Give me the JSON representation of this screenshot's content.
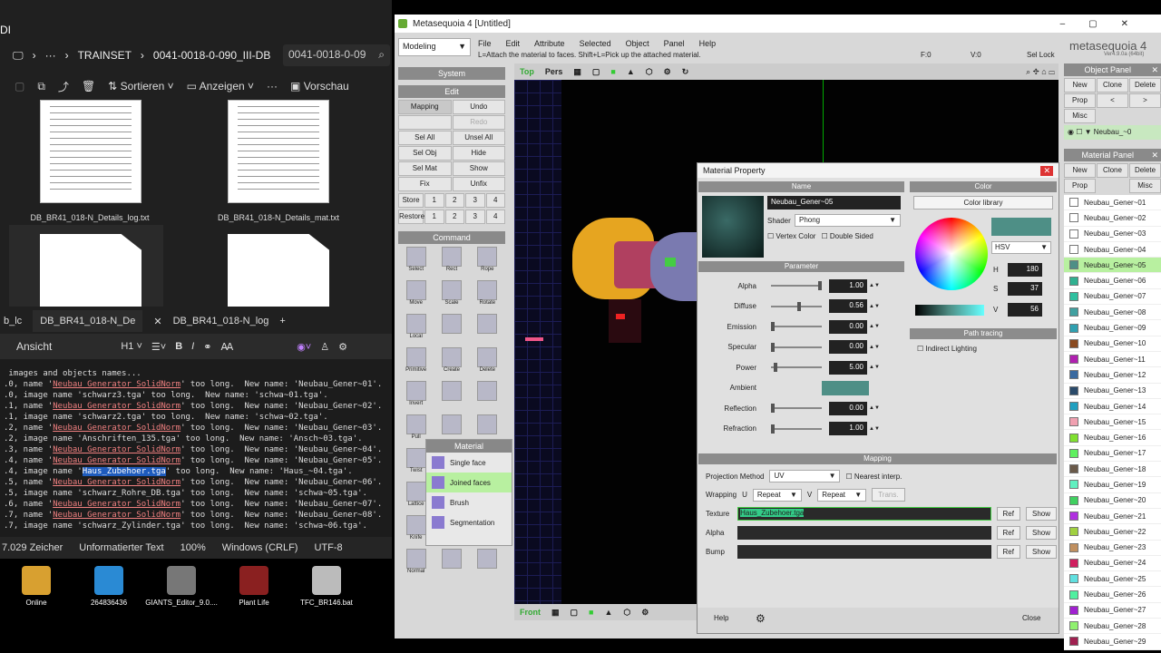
{
  "explorer": {
    "title_fragment": "DI",
    "breadcrumb": [
      "TRAINSET",
      "0041-0018-0-090_III-DB"
    ],
    "search_text": "0041-0018-0-09",
    "toolbar": {
      "sort": "Sortieren",
      "view": "Anzeigen",
      "more": "···",
      "preview": "Vorschau"
    },
    "files": [
      "DB_BR41_018-N_Details_log.txt",
      "DB_BR41_018-N_Details_mat.txt"
    ]
  },
  "editor": {
    "tabs": [
      "b_lc",
      "DB_BR41_018-N_De",
      "DB_BR41_018-N_log",
      "+"
    ],
    "view_label": "Ansicht",
    "heading_sel": "H1",
    "lines": [
      {
        "pre": " images and objects names...",
        "hl": "",
        "post": ""
      },
      {
        "pre": ".0, name '",
        "hl": "Neubau_Generator_SolidNorm",
        "post": "' too long.  New name: 'Neubau_Gener~01'."
      },
      {
        "pre": ".0, image name 'schwarz3.tga' too long.  New name: 'schwa~01.tga'.",
        "hl": "",
        "post": ""
      },
      {
        "pre": ".1, name '",
        "hl": "Neubau_Generator_SolidNorm",
        "post": "' too long.  New name: 'Neubau_Gener~02'."
      },
      {
        "pre": ".1, image name 'schwarz2.tga' too long.  New name: 'schwa~02.tga'.",
        "hl": "",
        "post": ""
      },
      {
        "pre": ".2, name '",
        "hl": "Neubau_Generator_SolidNorm",
        "post": "' too long.  New name: 'Neubau_Gener~03'."
      },
      {
        "pre": ".2, image name 'Anschriften_135.tga' too long.  New name: 'Ansch~03.tga'.",
        "hl": "",
        "post": ""
      },
      {
        "pre": ".3, name '",
        "hl": "Neubau_Generator_SolidNorm",
        "post": "' too long.  New name: 'Neubau_Gener~04'."
      },
      {
        "pre": ".4, name '",
        "hl": "Neubau_Generator_SolidNorm",
        "post": "' too long.  New name: 'Neubau_Gener~05'."
      },
      {
        "pre": ".4, image name '",
        "sel": "Haus_Zubehoer.tga",
        "post": "' too long.  New name: 'Haus_~04.tga'."
      },
      {
        "pre": ".5, name '",
        "hl": "Neubau_Generator_SolidNorm",
        "post": "' too long.  New name: 'Neubau_Gener~06'."
      },
      {
        "pre": ".5, image name 'schwarz_Rohre_DB.tga' too long.  New name: 'schwa~05.tga'.",
        "hl": "",
        "post": ""
      },
      {
        "pre": ".6, name '",
        "hl": "Neubau_Generator_SolidNorm",
        "post": "' too long.  New name: 'Neubau_Gener~07'."
      },
      {
        "pre": ".7, name '",
        "hl": "Neubau_Generator_SolidNorm",
        "post": "' too long.  New name: 'Neubau_Gener~08'."
      },
      {
        "pre": ".7, image name 'schwarz_Zylinder.tga' too long.  New name: 'schwa~06.tga'.",
        "hl": "",
        "post": ""
      }
    ],
    "status": {
      "chars": "7.029 Zeicher",
      "format": "Unformatierter Text",
      "zoom": "100%",
      "eol": "Windows (CRLF)",
      "enc": "UTF-8"
    }
  },
  "desktop": [
    {
      "label": "Online",
      "color": "#d8a030"
    },
    {
      "label": "264836436",
      "color": "#2a8ad4"
    },
    {
      "label": "GIANTS_Editor_9.0....",
      "color": "#777777"
    },
    {
      "label": "Plant Life",
      "color": "#8a2020"
    },
    {
      "label": "TFC_BR146.bat",
      "color": "#bbbbbb"
    }
  ],
  "meta": {
    "title": "Metasequoia 4 [Untitled]",
    "mode": "Modeling",
    "menu": [
      "File",
      "Edit",
      "Attribute",
      "Selected",
      "Object",
      "Panel",
      "Help"
    ],
    "hint": "L=Attach the material to faces.  Shift+L=Pick up the attached material.",
    "status_f": "F:0",
    "status_v": "V:0",
    "sel_lock": "Sel Lock",
    "logo": "metasequoia 4",
    "version": "Ver4.9.0a (64bit)",
    "system_label": "System",
    "edit_label": "Edit",
    "edit_buttons": [
      "Mapping",
      "Undo",
      "",
      "Redo",
      "Sel All",
      "Unsel All",
      "Sel Obj",
      "Hide",
      "Sel Mat",
      "Show",
      "Fix",
      "Unfix"
    ],
    "store_label": "Store",
    "restore_label": "Restore",
    "slots": [
      "1",
      "2",
      "3",
      "4"
    ],
    "command_label": "Command",
    "commands": [
      "Select",
      "Rect",
      "Rope",
      "Move",
      "Scale",
      "Rotate",
      "Local",
      "",
      "",
      "Primitive",
      "Create",
      "Delete",
      "Invert",
      "",
      "",
      "Pull",
      "",
      "",
      "Twist",
      "",
      "",
      "Lattice",
      "Hole",
      "Bridge",
      "Knife",
      "Weight",
      "VertClr",
      "Normal",
      "",
      ""
    ],
    "view_top": [
      "Top",
      "Pers"
    ],
    "view_bottom": "Front",
    "flyout_title": "Material",
    "flyout_items": [
      "Single face",
      "Joined faces",
      "Brush",
      "Segmentation"
    ]
  },
  "object_panel": {
    "title": "Object Panel",
    "buttons": [
      "New",
      "Clone",
      "Delete",
      "Prop",
      "<",
      ">",
      "Misc"
    ],
    "item": "Neubau_~0"
  },
  "material_panel": {
    "title": "Material Panel",
    "buttons": [
      "New",
      "Clone",
      "Delete",
      "Prop",
      "Misc"
    ],
    "items": [
      {
        "name": "Neubau_Gener~01",
        "color": "#ffffff"
      },
      {
        "name": "Neubau_Gener~02",
        "color": "#ffffff"
      },
      {
        "name": "Neubau_Gener~03",
        "color": "#ffffff"
      },
      {
        "name": "Neubau_Gener~04",
        "color": "#ffffff"
      },
      {
        "name": "Neubau_Gener~05",
        "color": "#4e8f86"
      },
      {
        "name": "Neubau_Gener~06",
        "color": "#30b090"
      },
      {
        "name": "Neubau_Gener~07",
        "color": "#30c0a0"
      },
      {
        "name": "Neubau_Gener~08",
        "color": "#40a0a0"
      },
      {
        "name": "Neubau_Gener~09",
        "color": "#30a0b0"
      },
      {
        "name": "Neubau_Gener~10",
        "color": "#8a4a20"
      },
      {
        "name": "Neubau_Gener~11",
        "color": "#b020b0"
      },
      {
        "name": "Neubau_Gener~12",
        "color": "#3a6aa0"
      },
      {
        "name": "Neubau_Gener~13",
        "color": "#2a4a6a"
      },
      {
        "name": "Neubau_Gener~14",
        "color": "#20a0c0"
      },
      {
        "name": "Neubau_Gener~15",
        "color": "#f0a0b0"
      },
      {
        "name": "Neubau_Gener~16",
        "color": "#80e030"
      },
      {
        "name": "Neubau_Gener~17",
        "color": "#60f060"
      },
      {
        "name": "Neubau_Gener~18",
        "color": "#6a5a4a"
      },
      {
        "name": "Neubau_Gener~19",
        "color": "#60f0c0"
      },
      {
        "name": "Neubau_Gener~20",
        "color": "#40d060"
      },
      {
        "name": "Neubau_Gener~21",
        "color": "#b030e0"
      },
      {
        "name": "Neubau_Gener~22",
        "color": "#a0d040"
      },
      {
        "name": "Neubau_Gener~23",
        "color": "#c09060"
      },
      {
        "name": "Neubau_Gener~24",
        "color": "#d02060"
      },
      {
        "name": "Neubau_Gener~25",
        "color": "#60e0e0"
      },
      {
        "name": "Neubau_Gener~26",
        "color": "#50f0a0"
      },
      {
        "name": "Neubau_Gener~27",
        "color": "#a020d0"
      },
      {
        "name": "Neubau_Gener~28",
        "color": "#90f070"
      },
      {
        "name": "Neubau_Gener~29",
        "color": "#a02050"
      }
    ]
  },
  "dialog": {
    "title": "Material Property",
    "name_section": "Name",
    "material_name": "Neubau_Gener~05",
    "shader_label": "Shader",
    "shader_value": "Phong",
    "vertex_color": "Vertex Color",
    "double_sided": "Double Sided",
    "param_section": "Parameter",
    "params": [
      {
        "label": "Alpha",
        "value": "1.00",
        "level": 1.0
      },
      {
        "label": "Diffuse",
        "value": "0.56",
        "level": 0.56
      },
      {
        "label": "Emission",
        "value": "0.00",
        "level": 0.0
      },
      {
        "label": "Specular",
        "value": "0.00",
        "level": 0.0
      },
      {
        "label": "Power",
        "value": "5.00",
        "level": 0.05
      },
      {
        "label": "Ambient",
        "value": "",
        "level": -1
      },
      {
        "label": "Reflection",
        "value": "0.00",
        "level": 0.0
      },
      {
        "label": "Refraction",
        "value": "1.00",
        "level": 0.0
      }
    ],
    "color_section": "Color",
    "color_library": "Color library",
    "color_mode": "HSV",
    "h_label": "H",
    "h_value": "180",
    "s_label": "S",
    "s_value": "37",
    "v_label": "V",
    "v_value": "56",
    "material_color": "#4e8f86",
    "path_section": "Path tracing",
    "indirect": "Indirect Lighting",
    "mapping_section": "Mapping",
    "proj_label": "Projection Method",
    "proj_value": "UV",
    "nearest": "Nearest interp.",
    "wrapping_label": "Wrapping",
    "u_label": "U",
    "u_value": "Repeat",
    "v_wrap_label": "V",
    "v_wrap_value": "Repeat",
    "trans": "Trans.",
    "texture_label": "Texture",
    "texture_value": "Haus_Zubehoer.tga",
    "alpha_label": "Alpha",
    "bump_label": "Bump",
    "ref": "Ref",
    "show": "Show",
    "help": "Help",
    "close": "Close"
  }
}
